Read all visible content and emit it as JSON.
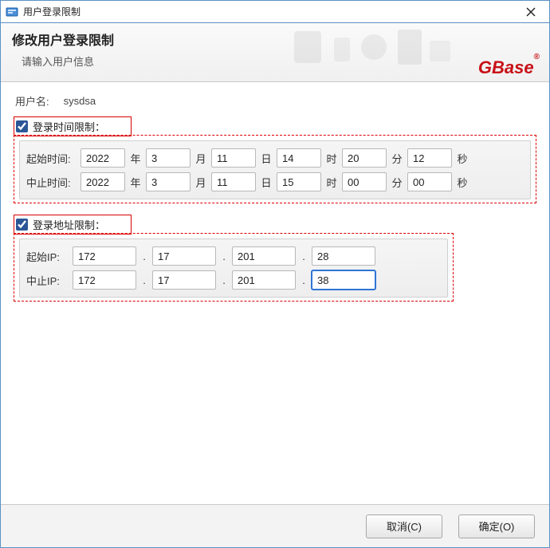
{
  "window": {
    "title": "用户登录限制"
  },
  "header": {
    "title": "修改用户登录限制",
    "subtitle": "请输入用户信息",
    "brand": "GBase"
  },
  "user": {
    "label": "用户名:",
    "value": "sysdsa"
  },
  "time_limit": {
    "checkbox_label": "登录时间限制",
    "colon": "：",
    "start_label": "起始时间:",
    "end_label": "中止时间:",
    "units": {
      "year": "年",
      "month": "月",
      "day": "日",
      "hour": "时",
      "minute": "分",
      "second": "秒"
    },
    "start": {
      "year": "2022",
      "month": "3",
      "day": "11",
      "hour": "14",
      "minute": "20",
      "second": "12"
    },
    "end": {
      "year": "2022",
      "month": "3",
      "day": "11",
      "hour": "15",
      "minute": "00",
      "second": "00"
    }
  },
  "addr_limit": {
    "checkbox_label": "登录地址限制",
    "colon": "：",
    "start_label": "起始IP:",
    "end_label": "中止IP:",
    "dot": ".",
    "start": {
      "a": "172",
      "b": "17",
      "c": "201",
      "d": "28"
    },
    "end": {
      "a": "172",
      "b": "17",
      "c": "201",
      "d": "38"
    }
  },
  "buttons": {
    "cancel": "取消(C)",
    "ok": "确定(O)"
  }
}
